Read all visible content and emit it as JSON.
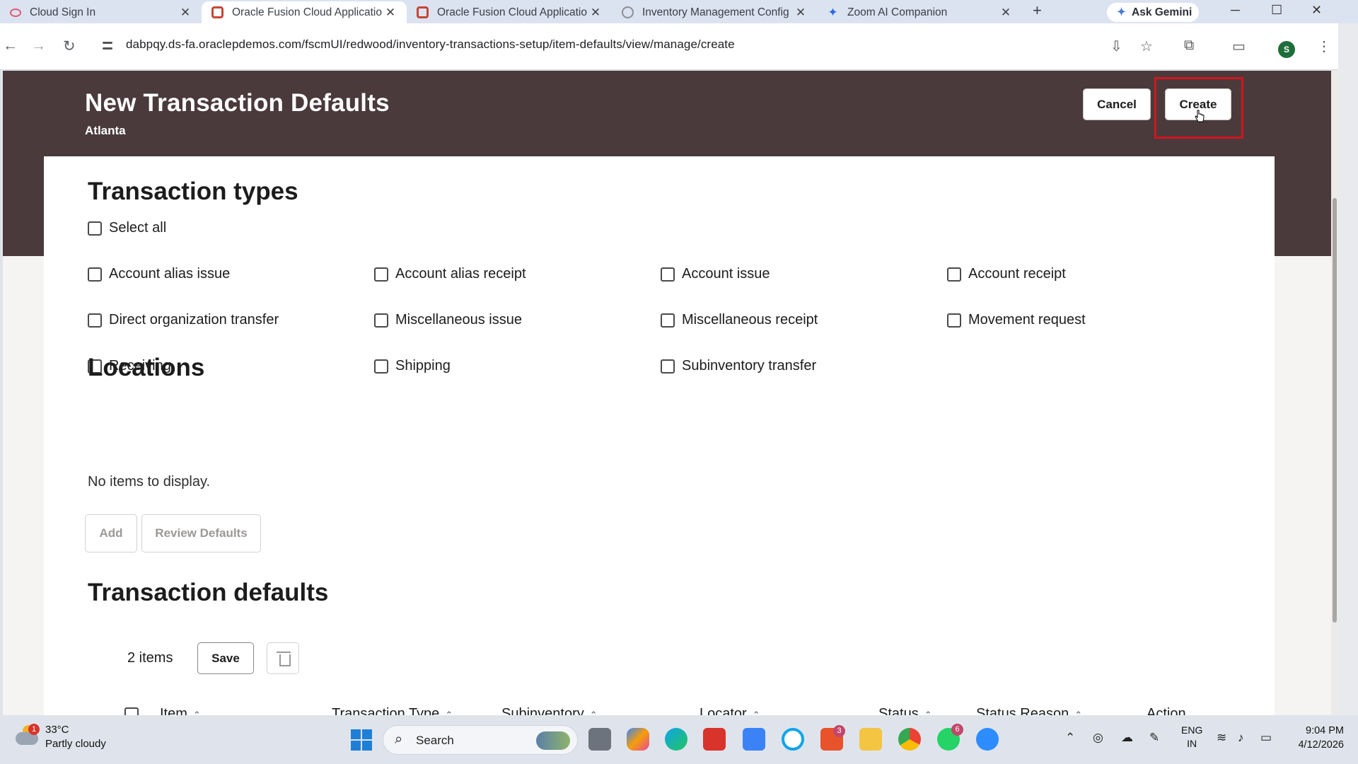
{
  "browser": {
    "tabs": [
      {
        "title": "Cloud Sign In",
        "icon": "oracle-pink-icon"
      },
      {
        "title": "Oracle Fusion Cloud Applicatio",
        "icon": "oracle-icon"
      },
      {
        "title": "Oracle Fusion Cloud Applicatio",
        "icon": "oracle-icon"
      },
      {
        "title": "Inventory Management Config",
        "icon": "globe-icon"
      },
      {
        "title": "Zoom AI Companion",
        "icon": "zoom-ai-icon"
      }
    ],
    "active_tab": 1,
    "gemini_label": "Ask Gemini",
    "url": "dabpqy.ds-fa.oraclepdemos.com/fscmUI/redwood/inventory-transactions-setup/item-defaults/view/manage/create",
    "profile_initial": "S"
  },
  "page": {
    "title": "New Transaction Defaults",
    "subtitle": "Atlanta",
    "cancel_label": "Cancel",
    "create_label": "Create",
    "accent_color": "#d3141c",
    "header_color": "#4a3a3c"
  },
  "transaction_types": {
    "heading": "Transaction types",
    "select_all": "Select all",
    "options": [
      [
        "Account alias issue",
        "Account alias receipt",
        "Account issue",
        "Account receipt"
      ],
      [
        "Direct organization transfer",
        "Miscellaneous issue",
        "Miscellaneous receipt",
        "Movement request"
      ],
      [
        "Receiving",
        "Shipping",
        "Subinventory transfer"
      ]
    ]
  },
  "locations": {
    "heading": "Locations",
    "empty_text": "No items to display.",
    "add_label": "Add",
    "review_label": "Review Defaults"
  },
  "transaction_defaults": {
    "heading": "Transaction defaults",
    "count_text": "2 items",
    "save_label": "Save",
    "columns": [
      "Item",
      "Transaction Type",
      "Subinventory",
      "Locator",
      "Status",
      "Status Reason",
      "Action"
    ]
  },
  "taskbar": {
    "temperature": "33°C",
    "condition": "Partly cloudy",
    "weather_badge": "1",
    "search_label": "Search",
    "lang_line1": "ENG",
    "lang_line2": "IN",
    "time": "9:04 PM",
    "date": "4/12/2026",
    "badges": {
      "office": "3",
      "whatsapp": "6"
    }
  }
}
